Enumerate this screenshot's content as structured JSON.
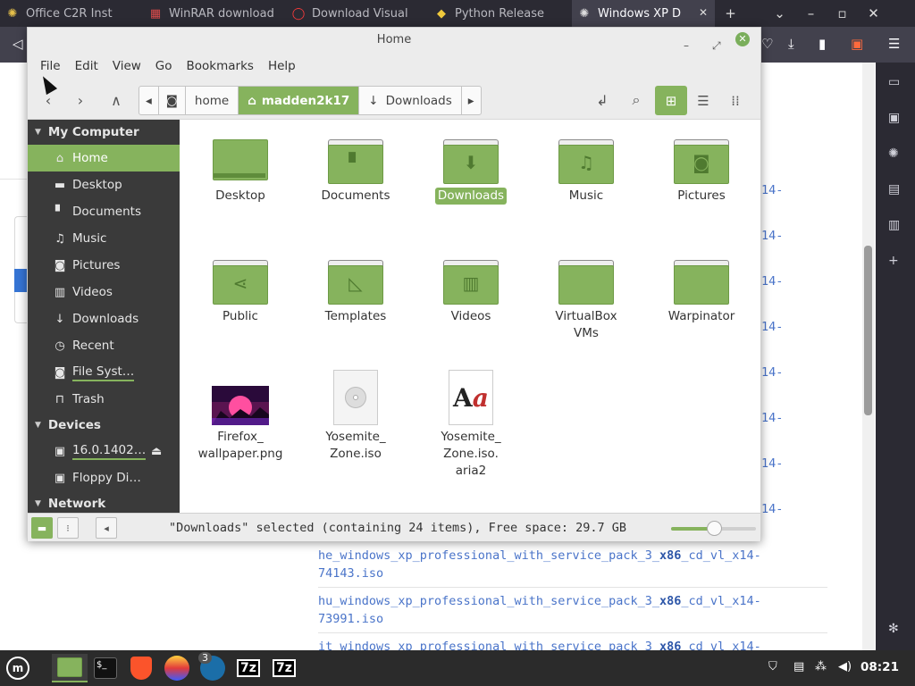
{
  "browser": {
    "tabs": [
      {
        "label": "Office C2R Inst",
        "icon": "gear-icon"
      },
      {
        "label": "WinRAR download",
        "icon": "winrar-icon"
      },
      {
        "label": "Download Visual",
        "icon": "opera-icon"
      },
      {
        "label": "Python Release",
        "icon": "python-icon"
      },
      {
        "label": "Windows XP D",
        "icon": "gear-icon",
        "active": true
      }
    ],
    "links": [
      {
        "name": "he_windows_xp_professional_with_service_pack_3_",
        "bold": "x86",
        "suffix": "_cd_vl_x14-",
        "line2": "74143.iso"
      },
      {
        "name": "hu_windows_xp_professional_with_service_pack_3_",
        "bold": "x86",
        "suffix": "_cd_vl_x14-",
        "line2": "73991.iso"
      },
      {
        "name": "it_windows_xp_professional_with_service_pack_3_",
        "bold": "x86",
        "suffix": "_cd_vl_x14-",
        "line2": ""
      }
    ],
    "edge_labels": [
      "14-",
      "14-",
      "14-",
      "14-",
      "14-",
      "14-",
      "14-",
      "14-"
    ]
  },
  "window": {
    "title": "Home",
    "menu": [
      "File",
      "Edit",
      "View",
      "Go",
      "Bookmarks",
      "Help"
    ],
    "path": [
      "home",
      "madden2k17",
      "Downloads"
    ],
    "places": {
      "my_computer": "My Computer",
      "items": [
        "Home",
        "Desktop",
        "Documents",
        "Music",
        "Pictures",
        "Videos",
        "Downloads",
        "Recent",
        "File Syst…",
        "Trash"
      ],
      "devices": "Devices",
      "device_items": [
        "16.0.1402…",
        "Floppy Di…"
      ],
      "network": "Network"
    },
    "files": [
      {
        "label": "Desktop"
      },
      {
        "label": "Documents"
      },
      {
        "label": "Downloads",
        "selected": true
      },
      {
        "label": "Music"
      },
      {
        "label": "Pictures"
      },
      {
        "label": "Public"
      },
      {
        "label": "Templates"
      },
      {
        "label": "Videos"
      },
      {
        "label": "VirtualBox\nVMs"
      },
      {
        "label": "Warpinator"
      },
      {
        "label": "Firefox_\nwallpaper.png"
      },
      {
        "label": "Yosemite_\nZone.iso"
      },
      {
        "label": "Yosemite_\nZone.iso.\naria2"
      }
    ],
    "status": "\"Downloads\" selected (containing 24 items), Free space: 29.7 GB",
    "zoom_level": 0.5
  },
  "taskbar": {
    "clock": "08:21",
    "steam_badge": "3",
    "sevenzip": "7z"
  }
}
